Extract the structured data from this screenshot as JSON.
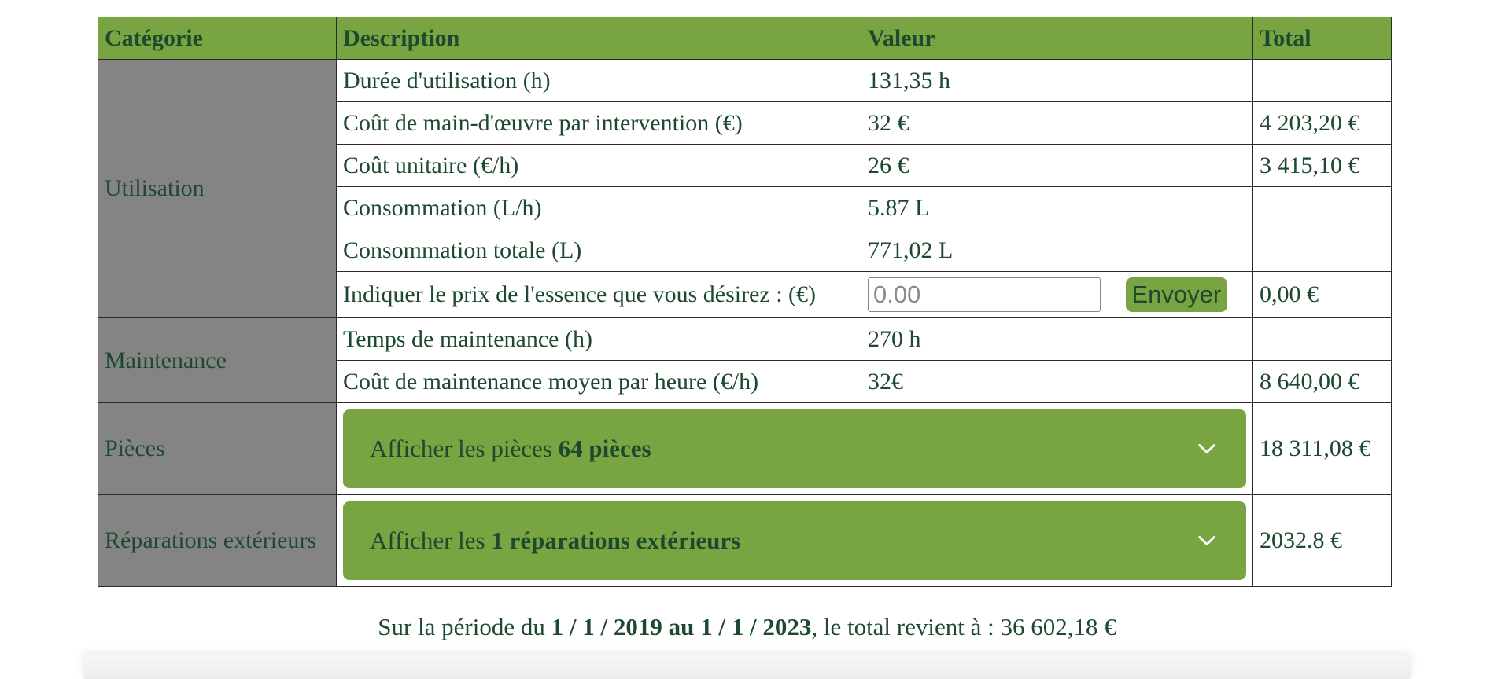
{
  "table": {
    "headers": {
      "category": "Catégorie",
      "description": "Description",
      "value": "Valeur",
      "total": "Total"
    },
    "utilisation": {
      "category": "Utilisation",
      "rows": [
        {
          "description": "Durée d'utilisation (h)",
          "value": "131,35 h",
          "total": ""
        },
        {
          "description": "Coût de main-d'œuvre par intervention (€)",
          "value": "32 €",
          "total": "4 203,20 €"
        },
        {
          "description": "Coût unitaire (€/h)",
          "value": "26 €",
          "total": "3 415,10 €"
        },
        {
          "description": "Consommation (L/h)",
          "value": "5.87 L",
          "total": ""
        },
        {
          "description": "Consommation totale (L)",
          "value": "771,02 L",
          "total": ""
        }
      ],
      "fuel": {
        "description": "Indiquer le prix de l'essence que vous désirez : (€)",
        "placeholder": "0.00",
        "button": "Envoyer",
        "total": "0,00 €"
      }
    },
    "maintenance": {
      "category": "Maintenance",
      "rows": [
        {
          "description": "Temps de maintenance (h)",
          "value": "270 h",
          "total": ""
        },
        {
          "description": "Coût de maintenance moyen par heure (€/h)",
          "value": "32€",
          "total": "8 640,00 €"
        }
      ]
    },
    "pieces": {
      "category": "Pièces",
      "label_prefix": "Afficher les pièces ",
      "label_bold": "64 pièces",
      "total": "18 311,08 €"
    },
    "reparations": {
      "category": "Réparations extérieurs",
      "label_prefix": "Afficher les ",
      "label_bold": "1 réparations extérieurs",
      "total": "2032.8 €"
    }
  },
  "summary": {
    "prefix": "Sur la période du ",
    "period": "1 / 1 / 2019 au 1 / 1 / 2023",
    "suffix": ", le total revient à : 36 602,18 €"
  },
  "icons": {
    "accordion": "chevron-down-icon"
  },
  "colors": {
    "header_green": "#78a441",
    "category_gray": "#848484",
    "text_dark_green": "#1d4a2e"
  }
}
